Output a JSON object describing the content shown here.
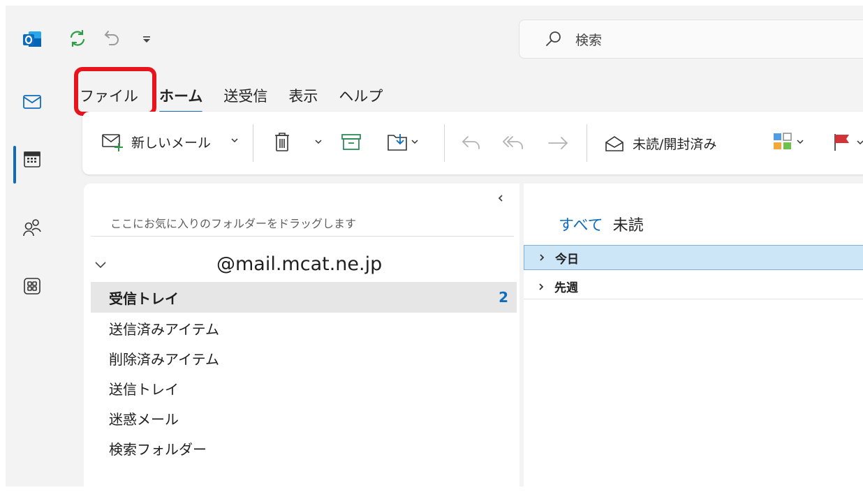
{
  "search": {
    "placeholder": "検索"
  },
  "menu_tabs": [
    {
      "label": "ファイル"
    },
    {
      "label": "ホーム"
    },
    {
      "label": "送受信"
    },
    {
      "label": "表示"
    },
    {
      "label": "ヘルプ"
    }
  ],
  "active_tab": "ホーム",
  "ribbon": {
    "new_mail": "新しいメール",
    "unread_read": "未読/開封済み"
  },
  "folders": {
    "favorites_hint": "ここにお気に入りのフォルダーをドラッグします",
    "account": "@mail.mcat.ne.jp",
    "items": [
      {
        "label": "受信トレイ",
        "count": "2",
        "selected": true
      },
      {
        "label": "送信済みアイテム"
      },
      {
        "label": "削除済みアイテム"
      },
      {
        "label": "送信トレイ"
      },
      {
        "label": "迷惑メール"
      },
      {
        "label": "検索フォルダー"
      }
    ]
  },
  "mail_list": {
    "filter_tabs": [
      {
        "label": "すべて"
      },
      {
        "label": "未読"
      }
    ],
    "groups": [
      {
        "label": "今日"
      },
      {
        "label": "先週"
      }
    ]
  },
  "colors": {
    "accent": "#0f6cbd",
    "highlight_box": "#e8141c",
    "selected_group_bg": "#cde6f7",
    "flag_red": "#d13438"
  },
  "icons": {
    "app": "outlook-icon",
    "rail": [
      "mail-icon",
      "calendar-icon",
      "people-icon",
      "apps-icon"
    ]
  }
}
